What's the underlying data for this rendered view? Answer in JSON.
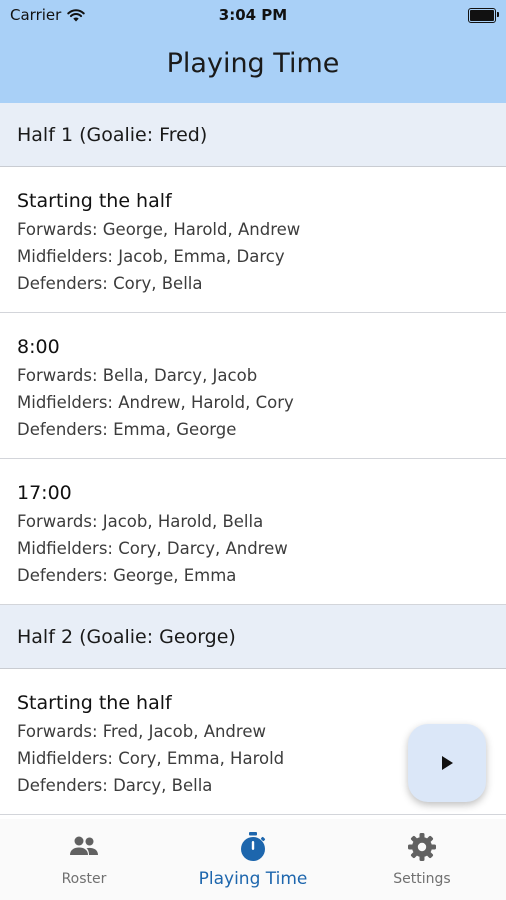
{
  "status_bar": {
    "carrier": "Carrier",
    "time": "3:04 PM"
  },
  "header": {
    "title": "Playing Time"
  },
  "halves": [
    {
      "title": "Half 1 (Goalie: Fred)",
      "entries": [
        {
          "time": "Starting the half",
          "forwards": "Forwards: George, Harold, Andrew",
          "midfielders": "Midfielders: Jacob, Emma, Darcy",
          "defenders": "Defenders: Cory, Bella"
        },
        {
          "time": "8:00",
          "forwards": "Forwards: Bella, Darcy, Jacob",
          "midfielders": "Midfielders: Andrew, Harold, Cory",
          "defenders": "Defenders: Emma, George"
        },
        {
          "time": "17:00",
          "forwards": "Forwards: Jacob, Harold, Bella",
          "midfielders": "Midfielders: Cory, Darcy, Andrew",
          "defenders": "Defenders: George, Emma"
        }
      ]
    },
    {
      "title": "Half 2 (Goalie: George)",
      "entries": [
        {
          "time": "Starting the half",
          "forwards": "Forwards: Fred, Jacob, Andrew",
          "midfielders": "Midfielders: Cory, Emma, Harold",
          "defenders": "Defenders: Darcy, Bella"
        }
      ]
    }
  ],
  "fab": {
    "icon": "play-icon"
  },
  "tabs": [
    {
      "label": "Roster",
      "icon": "people-icon",
      "active": false
    },
    {
      "label": "Playing Time",
      "icon": "stopwatch-icon",
      "active": true
    },
    {
      "label": "Settings",
      "icon": "gear-icon",
      "active": false
    }
  ],
  "colors": {
    "header": "#a9d0f7",
    "section": "#e8eef7",
    "accent": "#1d66ad",
    "fab": "#dbe7f8",
    "inactive": "#707070"
  }
}
